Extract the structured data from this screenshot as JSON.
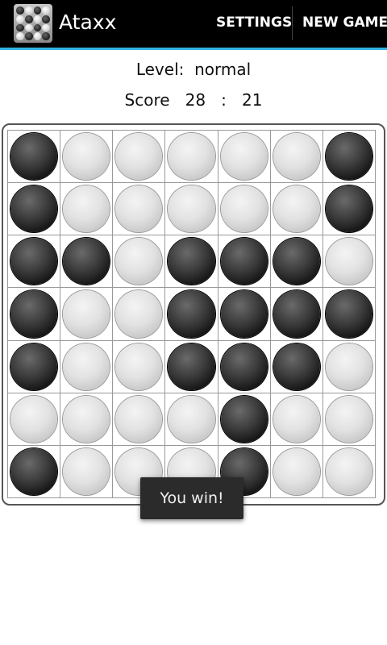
{
  "app": {
    "title": "Ataxx",
    "icon": "ataxx-board-icon"
  },
  "actions": {
    "settings_label": "SETTINGS",
    "new_game_label": "NEW GAME"
  },
  "status": {
    "level_label": "Level:",
    "level_value": "normal",
    "score_label": "Score",
    "score_player": "28",
    "score_separator": ":",
    "score_opponent": "21"
  },
  "board": {
    "size": 7,
    "rows": [
      [
        "B",
        "W",
        "W",
        "W",
        "W",
        "W",
        "B"
      ],
      [
        "B",
        "W",
        "W",
        "W",
        "W",
        "W",
        "B"
      ],
      [
        "B",
        "B",
        "W",
        "B",
        "B",
        "B",
        "W"
      ],
      [
        "B",
        "W",
        "W",
        "B",
        "B",
        "B",
        "B"
      ],
      [
        "B",
        "W",
        "W",
        "B",
        "B",
        "B",
        "W"
      ],
      [
        "W",
        "W",
        "W",
        "W",
        "B",
        "W",
        "W"
      ],
      [
        "B",
        "W",
        "W",
        "W",
        "B",
        "W",
        "W"
      ]
    ]
  },
  "toast": {
    "message": "You win!"
  },
  "colors": {
    "action_bar": "#000000",
    "accent": "#33b5e5",
    "toast_bg": "#2b2b2b"
  }
}
